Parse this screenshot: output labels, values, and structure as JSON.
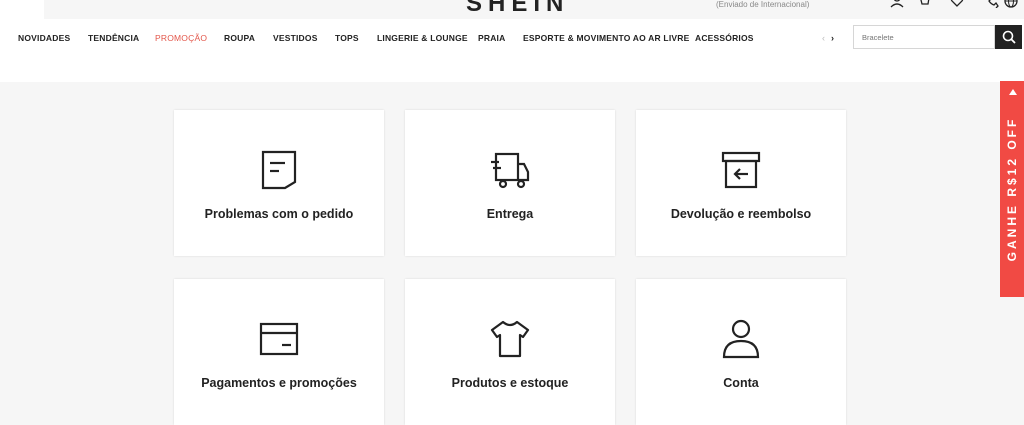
{
  "header": {
    "logo": "SHEIN",
    "shipping_note": "(Enviado de Internacional)"
  },
  "nav": {
    "items": [
      "NOVIDADES",
      "TENDÊNCIA",
      "PROMOÇÃO",
      "ROUPA",
      "VESTIDOS",
      "TOPS",
      "LINGERIE & LOUNGE",
      "PRAIA",
      "ESPORTE & MOVIMENTO AO AR LIVRE",
      "ACESSÓRIOS"
    ],
    "active_item": "PROMOÇÃO",
    "prev_arrow": "‹",
    "next_arrow": "›"
  },
  "search": {
    "placeholder": "Bracelete"
  },
  "help_cards": [
    {
      "label": "Problemas com o pedido",
      "icon": "order-document-icon"
    },
    {
      "label": "Entrega",
      "icon": "delivery-truck-icon"
    },
    {
      "label": "Devolução e reembolso",
      "icon": "return-box-icon"
    },
    {
      "label": "Pagamentos e promoções",
      "icon": "payment-card-icon"
    },
    {
      "label": "Produtos e estoque",
      "icon": "tshirt-icon"
    },
    {
      "label": "Conta",
      "icon": "account-user-icon"
    }
  ],
  "promo_tab": {
    "text": "GANHE R$12 OFF"
  },
  "colors": {
    "accent_red": "#e3564a",
    "promo_red": "#f14a44",
    "dark": "#222222"
  }
}
